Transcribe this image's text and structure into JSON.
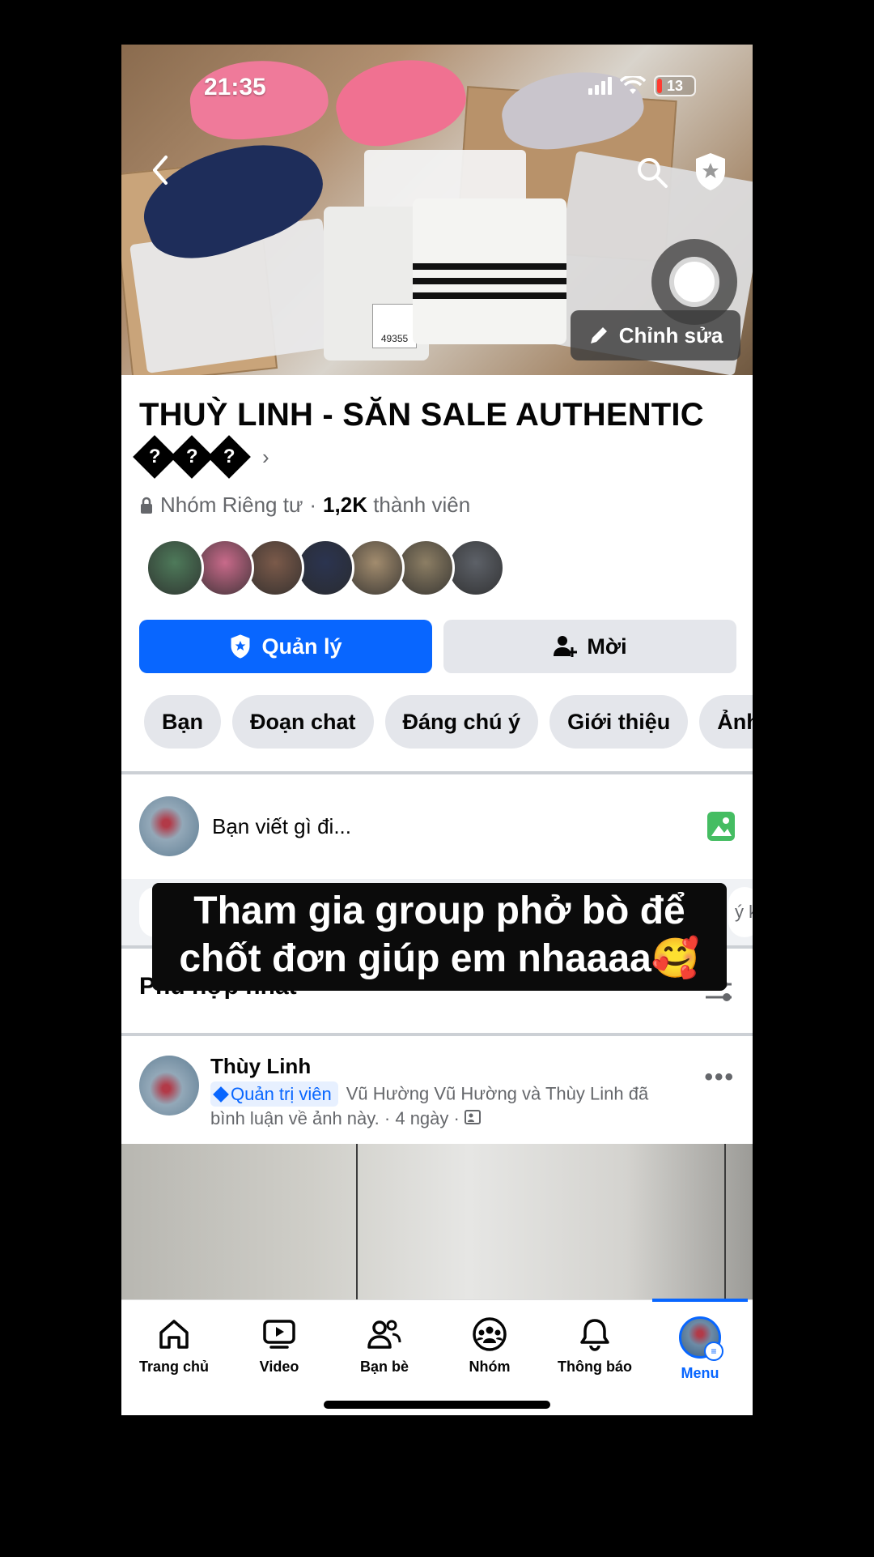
{
  "status_bar": {
    "time": "21:35",
    "battery": "13"
  },
  "cover": {
    "edit_label": "Chỉnh sửa",
    "box_label": "49355"
  },
  "group": {
    "name": "THUỲ LINH - SĂN SALE AUTHENTIC",
    "title_glyphs": [
      "?",
      "?",
      "?"
    ],
    "chevron": "›",
    "privacy": "Nhóm Riêng tư",
    "separator": "·",
    "member_count": "1,2K",
    "member_suffix": "thành viên",
    "member_avatar_colors": [
      "#4e7a5a",
      "#c86a8a",
      "#7b5a4a",
      "#2b3450",
      "#a28c6e",
      "#8c7e64",
      "#5d6168"
    ]
  },
  "actions": {
    "manage": "Quản lý",
    "invite": "Mời"
  },
  "tabs": [
    "Bạn",
    "Đoạn chat",
    "Đáng chú ý",
    "Giới thiệu",
    "Ảnh"
  ],
  "composer": {
    "placeholder": "Bạn viết gì đi..."
  },
  "stories_row": {
    "right_text": "ý k"
  },
  "sort": {
    "label": "Phù hợp nhất"
  },
  "caption": {
    "line1": "Tham gia group  phở bò để",
    "line2": "chốt đơn giúp em nhaaaa🥰"
  },
  "post": {
    "author": "Thùy Linh",
    "badge": "Quản trị viên",
    "activity": "Vũ Hường Vũ Hường và Thùy Linh đã bình luận về ảnh này.",
    "dot": "·",
    "time": "4 ngày",
    "more": "•••"
  },
  "nav": [
    {
      "label": "Trang chủ",
      "icon": "home-icon"
    },
    {
      "label": "Video",
      "icon": "video-icon"
    },
    {
      "label": "Bạn bè",
      "icon": "friends-icon"
    },
    {
      "label": "Nhóm",
      "icon": "groups-icon"
    },
    {
      "label": "Thông báo",
      "icon": "bell-icon"
    },
    {
      "label": "Menu",
      "icon": "menu-avatar",
      "active": true
    }
  ],
  "colors": {
    "primary": "#0866ff",
    "chip_bg": "#e4e6eb",
    "secondary_text": "#65676b",
    "photo_green": "#45bd62"
  }
}
